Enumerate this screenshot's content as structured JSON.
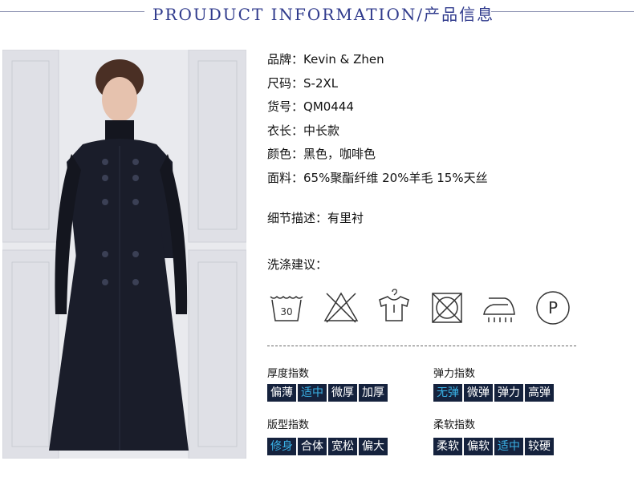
{
  "header": {
    "title": "PROUDUCT INFORMATION/产品信息"
  },
  "info": [
    {
      "label": "品牌：",
      "value": "Kevin & Zhen"
    },
    {
      "label": "尺码：",
      "value": "S-2XL"
    },
    {
      "label": "货号：",
      "value": "QM0444"
    },
    {
      "label": "衣长：",
      "value": "中长款"
    },
    {
      "label": "颜色：",
      "value": "黑色，咖啡色"
    },
    {
      "label": "面料：",
      "value": "65%聚酯纤维 20%羊毛 15%天丝"
    }
  ],
  "detail": {
    "label": "细节描述：",
    "value": "有里衬"
  },
  "care": {
    "title": "洗涤建议：",
    "wash_temp": "30",
    "pro_clean_letter": "P",
    "icons": [
      "wash-30-icon",
      "no-bleach-icon",
      "hang-dry-icon",
      "no-tumble-dry-icon",
      "iron-steam-icon",
      "professional-clean-p-icon"
    ]
  },
  "indices": [
    {
      "title": "厚度指数",
      "options": [
        "偏薄",
        "适中",
        "微厚",
        "加厚"
      ],
      "selected": 1
    },
    {
      "title": "弹力指数",
      "options": [
        "无弹",
        "微弹",
        "弹力",
        "高弹"
      ],
      "selected": 0
    },
    {
      "title": "版型指数",
      "options": [
        "修身",
        "合体",
        "宽松",
        "偏大"
      ],
      "selected": 0
    },
    {
      "title": "柔软指数",
      "options": [
        "柔软",
        "偏软",
        "适中",
        "较硬"
      ],
      "selected": 2
    }
  ],
  "colors": {
    "title": "#2f3a8c",
    "scale_bg": "#15223d",
    "scale_on": "#3ab2e6",
    "dress": "#1a1d2a"
  }
}
